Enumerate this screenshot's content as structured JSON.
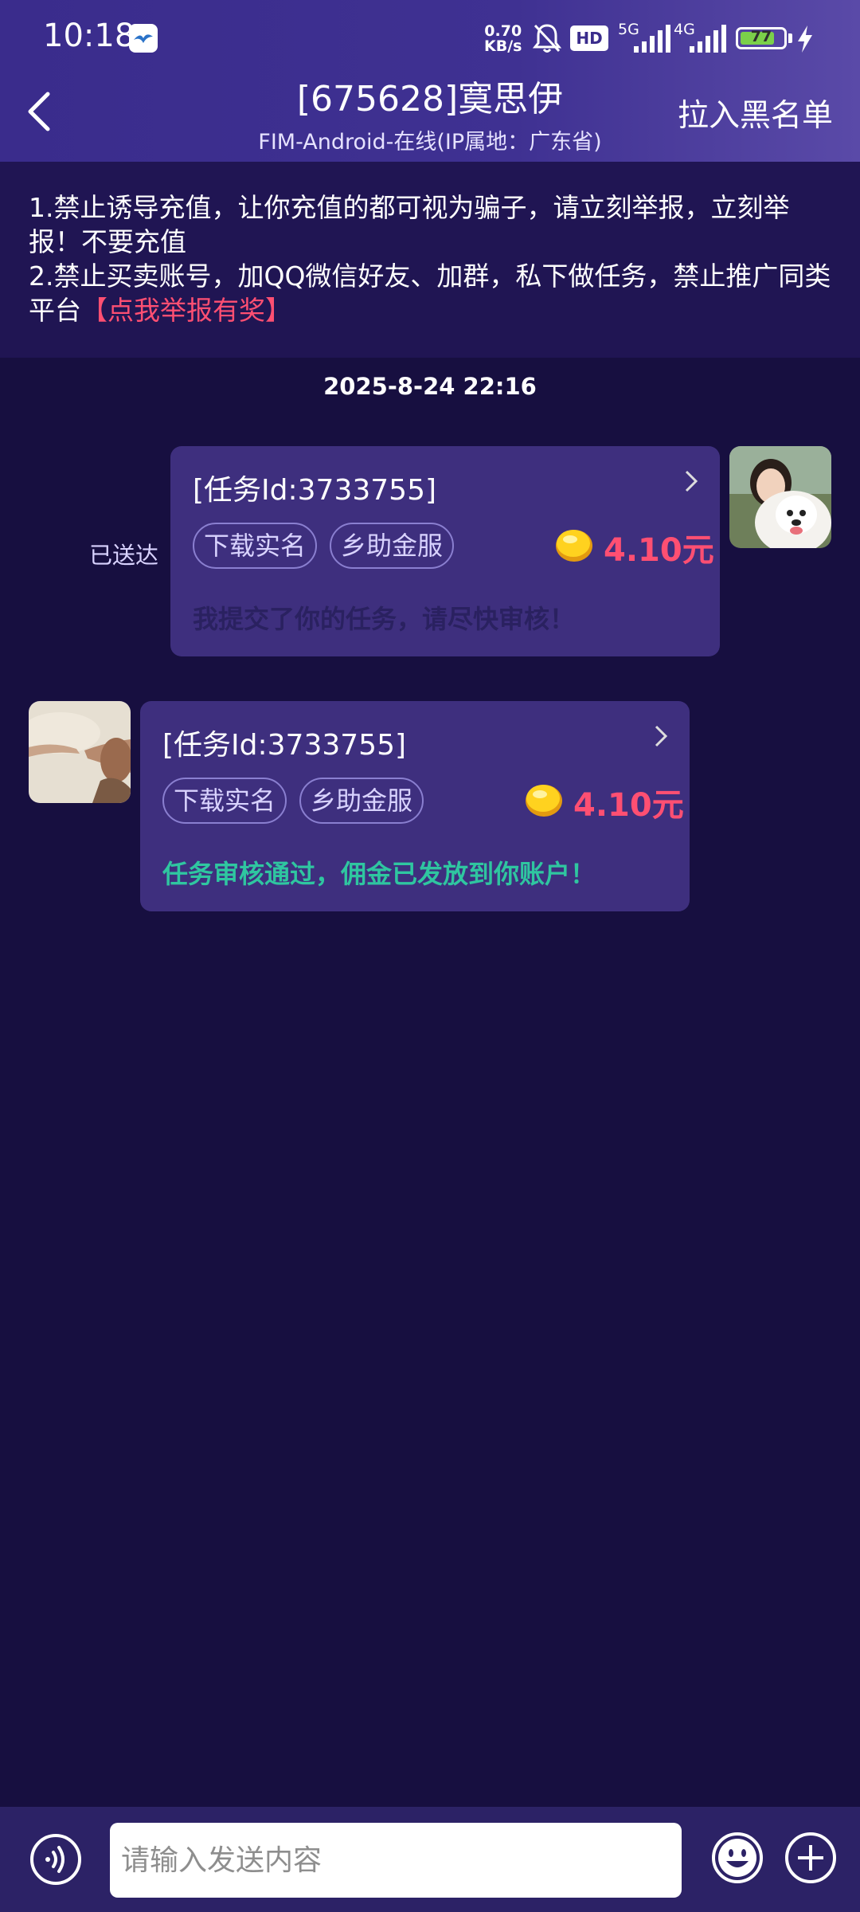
{
  "status_bar": {
    "time": "10:18",
    "net_speed_value": "0.70",
    "net_speed_unit": "KB/s",
    "hd_label": "HD",
    "signal_5g": "5G",
    "signal_4g": "4G",
    "battery": "77"
  },
  "header": {
    "title": "[675628]寞思伊",
    "subtitle": "FIM-Android-在线(IP属地：广东省)",
    "blacklist_label": "拉入黑名单"
  },
  "notice": {
    "line1": "1.禁止诱导充值，让你充值的都可视为骗子，请立刻举报，立刻举报！不要充值",
    "line2": "2.禁止买卖账号，加QQ微信好友、加群，私下做任务，禁止推广同类平台",
    "report_link": "【点我举报有奖】"
  },
  "timestamp": "2025-8-24 22:16",
  "messages": [
    {
      "side": "right",
      "task_id": "[任务Id:3733755]",
      "tags": [
        "下载实名",
        "乡助金服"
      ],
      "reward": "4.10元",
      "text": "我提交了你的任务，请尽快审核！",
      "status": "已送达"
    },
    {
      "side": "left",
      "task_id": "[任务Id:3733755]",
      "tags": [
        "下载实名",
        "乡助金服"
      ],
      "reward": "4.10元",
      "text": "任务审核通过，佣金已发放到你账户！"
    }
  ],
  "input": {
    "placeholder": "请输入发送内容"
  },
  "colors": {
    "background": "#170f40",
    "header": "#3a2c8c",
    "bubble": "#3e2f7e",
    "reward_red": "#ff4f72",
    "approved_green": "#2fc6a0",
    "pending_text": "#2a2160"
  }
}
